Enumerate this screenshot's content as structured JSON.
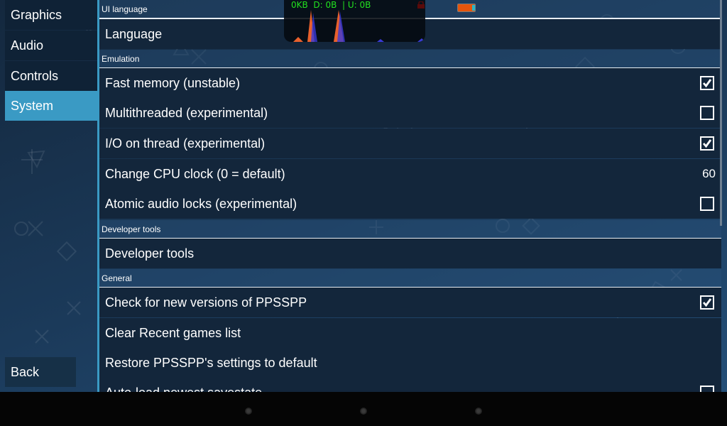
{
  "sidebar": {
    "tabs": [
      {
        "label": "Graphics",
        "active": false
      },
      {
        "label": "Audio",
        "active": false
      },
      {
        "label": "Controls",
        "active": false
      },
      {
        "label": "System",
        "active": true
      }
    ],
    "back_label": "Back"
  },
  "overlay": {
    "net_text": "0KB  D: 0B  | U: 0B"
  },
  "sections": {
    "ui_language": {
      "header": "UI language",
      "items": [
        {
          "label": "Language"
        }
      ]
    },
    "emulation": {
      "header": "Emulation",
      "items": [
        {
          "label": "Fast memory (unstable)",
          "type": "checkbox",
          "checked": true
        },
        {
          "label": "Multithreaded (experimental)",
          "type": "checkbox",
          "checked": false
        },
        {
          "label": "I/O on thread (experimental)",
          "type": "checkbox",
          "checked": true
        },
        {
          "label": "Change CPU clock (0 = default)",
          "type": "value",
          "value": "60"
        },
        {
          "label": "Atomic audio locks (experimental)",
          "type": "checkbox",
          "checked": false
        }
      ]
    },
    "developer_tools": {
      "header": "Developer tools",
      "items": [
        {
          "label": "Developer tools"
        }
      ]
    },
    "general": {
      "header": "General",
      "items": [
        {
          "label": "Check for new versions of PPSSPP",
          "type": "checkbox",
          "checked": true
        },
        {
          "label": "Clear Recent games list"
        },
        {
          "label": "Restore PPSSPP's settings to default"
        },
        {
          "label": "Auto-load newest savestate",
          "type": "checkbox",
          "checked": false
        }
      ]
    }
  },
  "colors": {
    "accent": "#3a9ac4",
    "overlay_text": "#22e21f",
    "row_bg": "#13263b"
  }
}
